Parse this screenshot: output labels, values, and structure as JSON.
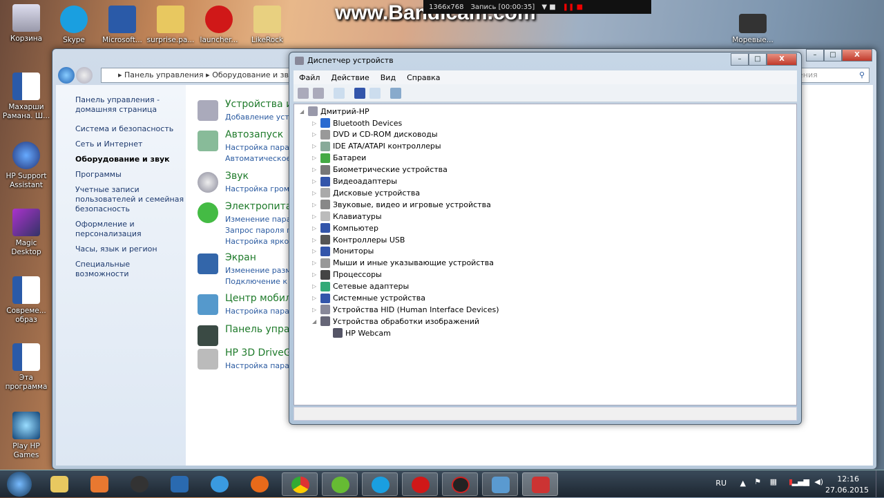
{
  "desktop": {
    "icons_left": [
      "Корзина",
      "Махарши Рамана. Ш...",
      "HP Support Assistant",
      "Magic Desktop",
      "Совреме... образ",
      "Эта программа",
      "Play HP Games"
    ],
    "icons_top": [
      "Skype",
      "Microsoft...",
      "surprise.pa...",
      "launcher...",
      "LikeRock"
    ],
    "icon_right": "Моревые..."
  },
  "bandicam": {
    "watermark": "www.Bandicam.com",
    "resolution": "1366x768",
    "recording": "Запись [00:00:35]"
  },
  "control_panel": {
    "breadcrumb": [
      "Панель управления",
      "Оборудование и звук"
    ],
    "search_placeholder": "ения",
    "nav": [
      "Панель управления - домашняя страница",
      "Система и безопасность",
      "Сеть и Интернет",
      "Оборудование и звук",
      "Программы",
      "Учетные записи пользователей и семейная безопасность",
      "Оформление и персонализация",
      "Часы, язык и регион",
      "Специальные возможности"
    ],
    "categories": [
      {
        "title": "Устройства и",
        "links": [
          "Добавление устро"
        ]
      },
      {
        "title": "Автозапуск",
        "links": [
          "Настройка парам",
          "Автоматическое"
        ]
      },
      {
        "title": "Звук",
        "links": [
          "Настройка громк"
        ]
      },
      {
        "title": "Электропитан",
        "links": [
          "Изменение парам",
          "Запрос пароля пр",
          "Настройка яркост"
        ]
      },
      {
        "title": "Экран",
        "links": [
          "Изменение разме",
          "Подключение к п"
        ]
      },
      {
        "title": "Центр мобил",
        "links": [
          "Настройка парам"
        ]
      },
      {
        "title": "Панель управ",
        "links": []
      },
      {
        "title": "HP 3D DriveG",
        "links": [
          "Настройка парам"
        ]
      }
    ]
  },
  "device_manager": {
    "title": "Диспетчер устройств",
    "menu": [
      "Файл",
      "Действие",
      "Вид",
      "Справка"
    ],
    "root": "Дмитрий-HP",
    "devices": [
      "Bluetooth Devices",
      "DVD и CD-ROM дисководы",
      "IDE ATA/ATAPI контроллеры",
      "Батареи",
      "Биометрические устройства",
      "Видеоадаптеры",
      "Дисковые устройства",
      "Звуковые, видео и игровые устройства",
      "Клавиатуры",
      "Компьютер",
      "Контроллеры USB",
      "Мониторы",
      "Мыши и иные указывающие устройства",
      "Процессоры",
      "Сетевые адаптеры",
      "Системные устройства",
      "Устройства HID (Human Interface Devices)",
      "Устройства обработки изображений"
    ],
    "child": "HP Webcam"
  },
  "taskbar": {
    "lang": "RU",
    "time": "12:16",
    "date": "27.06.2015"
  }
}
